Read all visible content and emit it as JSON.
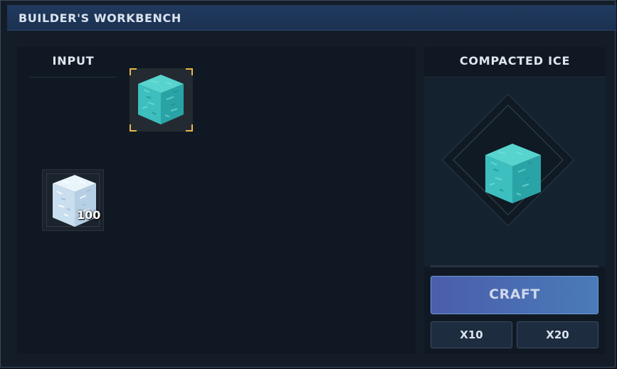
{
  "window": {
    "title": "BUILDER'S WORKBENCH"
  },
  "input_panel": {
    "header": "INPUT",
    "target_slot": {
      "item_icon": "compacted-ice-block-icon",
      "selected": true
    },
    "ingredient_slot": {
      "item_icon": "snow-ice-block-icon",
      "quantity": "100"
    }
  },
  "result_panel": {
    "header": "COMPACTED ICE",
    "preview_icon": "compacted-ice-block-icon",
    "craft_label": "CRAFT",
    "multiplier_x10": "X10",
    "multiplier_x20": "X20"
  },
  "colors": {
    "accent_gold": "#e8b64a",
    "craft_button": "#4a6ab4",
    "titlebar": "#1e365a",
    "compacted_ice": "#3cbfbe",
    "snow_ice": "#d4e6f2"
  }
}
